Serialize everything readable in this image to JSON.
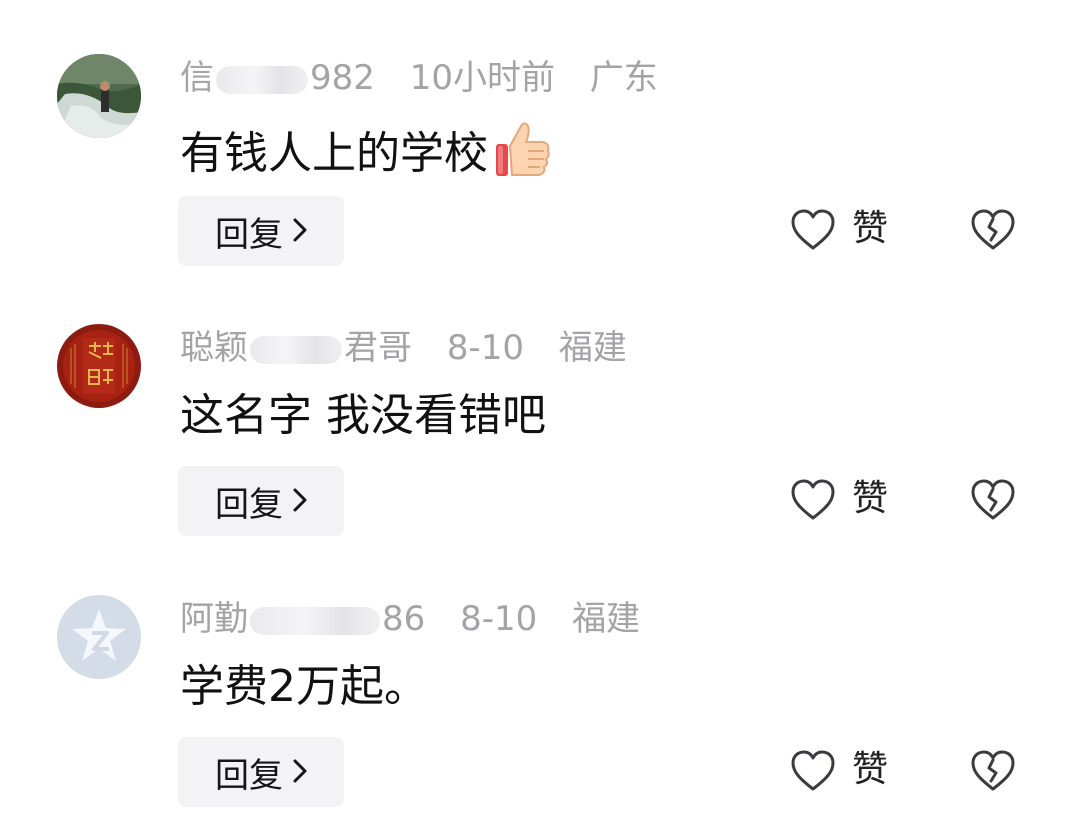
{
  "comments": [
    {
      "username_start": "信",
      "username_end": "982",
      "time": "10小时前",
      "region": "广东",
      "text": "有钱人上的学校",
      "emoji": "thumbs-up-icon",
      "avatar": "waterfall-person-photo",
      "reply_label": "回复",
      "like_label": "赞"
    },
    {
      "username_start": "聪颖",
      "username_end": "君哥",
      "time": "8-10",
      "region": "福建",
      "text": "这名字 我没看错吧",
      "avatar": "red-calligraphy-avatar",
      "reply_label": "回复",
      "like_label": "赞"
    },
    {
      "username_start": "阿勤",
      "username_end": "86",
      "time": "8-10",
      "region": "福建",
      "text": "学费2万起。",
      "avatar": "default-z-avatar",
      "reply_label": "回复",
      "like_label": "赞"
    }
  ],
  "colors": {
    "meta_text": "#a3a3a8",
    "body_text": "#111111",
    "reply_bg": "#f3f3f5",
    "icon_stroke": "#3c3c40"
  }
}
